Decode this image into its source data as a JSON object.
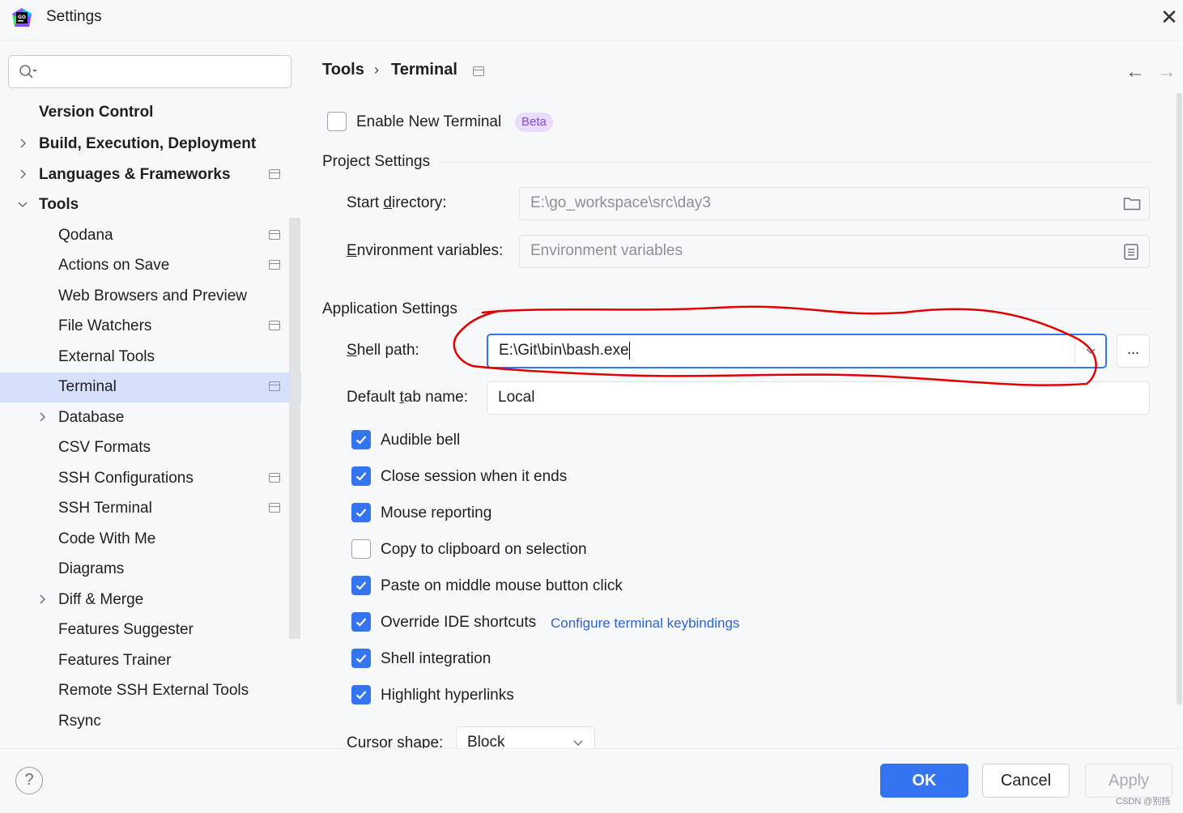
{
  "window": {
    "title": "Settings",
    "app_icon_label": "GO"
  },
  "sidebar": {
    "search_placeholder": "",
    "items": [
      {
        "label": "Version Control"
      },
      {
        "label": "Build, Execution, Deployment"
      },
      {
        "label": "Languages & Frameworks"
      },
      {
        "label": "Tools"
      },
      {
        "label": "Qodana"
      },
      {
        "label": "Actions on Save"
      },
      {
        "label": "Web Browsers and Preview"
      },
      {
        "label": "File Watchers"
      },
      {
        "label": "External Tools"
      },
      {
        "label": "Terminal",
        "selected": true
      },
      {
        "label": "Database"
      },
      {
        "label": "CSV Formats"
      },
      {
        "label": "SSH Configurations"
      },
      {
        "label": "SSH Terminal"
      },
      {
        "label": "Code With Me"
      },
      {
        "label": "Diagrams"
      },
      {
        "label": "Diff & Merge"
      },
      {
        "label": "Features Suggester"
      },
      {
        "label": "Features Trainer"
      },
      {
        "label": "Remote SSH External Tools"
      },
      {
        "label": "Rsync"
      }
    ]
  },
  "breadcrumb": {
    "parent": "Tools",
    "separator": "›",
    "current": "Terminal"
  },
  "terminal": {
    "enable_new_terminal": {
      "label": "Enable New Terminal",
      "checked": false,
      "badge": "Beta"
    },
    "project_settings": {
      "title": "Project Settings",
      "start_directory": {
        "label_prefix": "Start ",
        "label_mnemonic": "d",
        "label_suffix": "irectory:",
        "value": "E:\\go_workspace\\src\\day3"
      },
      "environment_variables": {
        "label_prefix": "",
        "label_mnemonic": "E",
        "label_suffix": "nvironment variables:",
        "placeholder": "Environment variables"
      }
    },
    "application_settings": {
      "title": "Application Settings",
      "shell_path": {
        "label_prefix": "",
        "label_mnemonic": "S",
        "label_suffix": "hell path:",
        "value": "E:\\Git\\bin\\bash.exe",
        "browse_label": "..."
      },
      "default_tab_name": {
        "label_prefix": "Default ",
        "label_mnemonic": "t",
        "label_suffix": "ab name:",
        "value": "Local"
      },
      "options": [
        {
          "label": "Audible bell",
          "checked": true
        },
        {
          "label": "Close session when it ends",
          "checked": true
        },
        {
          "label": "Mouse reporting",
          "checked": true
        },
        {
          "label": "Copy to clipboard on selection",
          "checked": false
        },
        {
          "label": "Paste on middle mouse button click",
          "checked": true
        },
        {
          "label": "Override IDE shortcuts",
          "checked": true
        },
        {
          "label": "Shell integration",
          "checked": true
        },
        {
          "label": "Highlight hyperlinks",
          "checked": true
        }
      ],
      "keybindings_link": "Configure terminal keybindings",
      "cursor_shape": {
        "label": "Cursor shape:",
        "value": "Block"
      }
    }
  },
  "footer": {
    "help": "?",
    "ok": "OK",
    "cancel": "Cancel",
    "apply": "Apply",
    "watermark": "CSDN @别挡"
  },
  "colors": {
    "accent": "#3574f0",
    "selection": "#d5e1fa",
    "beta_bg": "#e9dbfb",
    "annotation": "#e00000"
  }
}
